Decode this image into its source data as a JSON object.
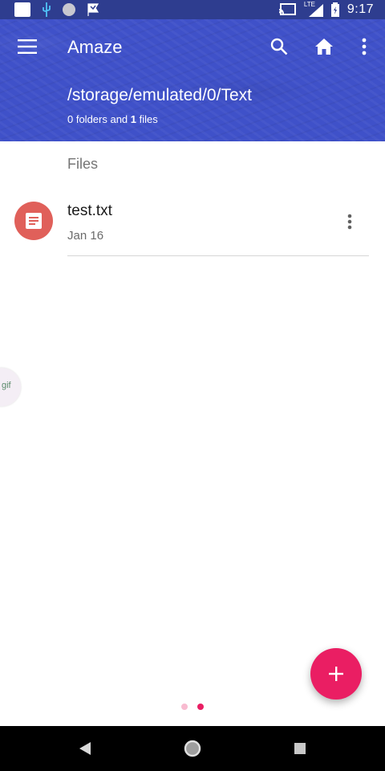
{
  "status_bar": {
    "time": "9:17",
    "network_label": "LTE",
    "icons": [
      "notification-square-icon",
      "usb-icon",
      "circle-icon",
      "flag-icon",
      "cast-icon",
      "signal-icon",
      "battery-icon"
    ]
  },
  "app_bar": {
    "title": "Amaze",
    "path": "/storage/emulated/0/Text",
    "summary_pre": "0 folders and ",
    "summary_count": "1",
    "summary_post": " files"
  },
  "content": {
    "section_header": "Files",
    "files": [
      {
        "name": "test.txt",
        "date": "Jan 16",
        "icon": "text-file-icon"
      }
    ]
  },
  "edge_bubble": {
    "text": "gif"
  },
  "page_indicator": {
    "count": 2,
    "active": 2
  },
  "colors": {
    "primary": "#3f51c9",
    "status_bar": "#2e3d8f",
    "accent": "#ea1e63",
    "file_icon_bg": "#e0605a",
    "dot_inactive": "#f8bbd0",
    "dot_active": "#e91e63"
  }
}
